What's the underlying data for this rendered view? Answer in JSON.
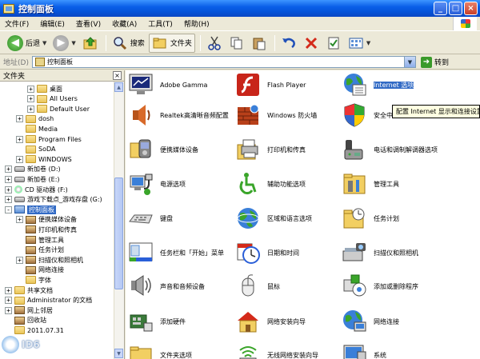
{
  "window": {
    "title": "控制面板",
    "minimize": "_",
    "maximize": "□",
    "close": "×"
  },
  "menubar": [
    "文件(F)",
    "编辑(E)",
    "查看(V)",
    "收藏(A)",
    "工具(T)",
    "帮助(H)"
  ],
  "toolbar": {
    "back": "后退",
    "search": "搜索",
    "folders": "文件夹"
  },
  "address": {
    "label": "地址(D)",
    "value": "控制面板",
    "go": "转到"
  },
  "folder_pane": {
    "title": "文件夹",
    "close": "×",
    "tree": [
      {
        "label": "桌面",
        "pm": "+",
        "icon": "folder"
      },
      {
        "label": "All Users",
        "pm": "+",
        "icon": "folder"
      },
      {
        "label": "Default User",
        "pm": "+",
        "icon": "folder"
      },
      {
        "label": "dosh",
        "pm": "+",
        "icon": "folder"
      },
      {
        "label": "Media",
        "pm": "",
        "icon": "folder"
      },
      {
        "label": "Program Files",
        "pm": "+",
        "icon": "folder"
      },
      {
        "label": "SoDA",
        "pm": "",
        "icon": "folder"
      },
      {
        "label": "WINDOWS",
        "pm": "+",
        "icon": "folder"
      },
      {
        "label": "新加卷 (D:)",
        "pm": "+",
        "icon": "drive"
      },
      {
        "label": "新加卷 (E:)",
        "pm": "+",
        "icon": "drive"
      },
      {
        "label": "CD 驱动器 (F:)",
        "pm": "+",
        "icon": "cd"
      },
      {
        "label": "游戏下载点_游戏存盘 (G:)",
        "pm": "+",
        "icon": "drive"
      },
      {
        "label": "控制面板",
        "pm": "-",
        "icon": "cp"
      },
      {
        "label": "便携媒体设备",
        "pm": "+",
        "icon": "misc"
      },
      {
        "label": "打印机和传真",
        "pm": "",
        "icon": "misc"
      },
      {
        "label": "管理工具",
        "pm": "",
        "icon": "misc"
      },
      {
        "label": "任务计划",
        "pm": "",
        "icon": "misc"
      },
      {
        "label": "扫描仪和照相机",
        "pm": "+",
        "icon": "misc"
      },
      {
        "label": "网络连接",
        "pm": "",
        "icon": "misc"
      },
      {
        "label": "字体",
        "pm": "",
        "icon": "folder"
      },
      {
        "label": "共享文档",
        "pm": "+",
        "icon": "folder"
      },
      {
        "label": "Administrator 的文档",
        "pm": "+",
        "icon": "folder"
      },
      {
        "label": "网上邻居",
        "pm": "+",
        "icon": "misc"
      },
      {
        "label": "回收站",
        "pm": "",
        "icon": "misc"
      },
      {
        "label": "2011.07.31",
        "pm": "",
        "icon": "folder"
      }
    ]
  },
  "items": [
    {
      "label": "Adobe Gamma",
      "icon": "monitor"
    },
    {
      "label": "Flash Player",
      "icon": "flash"
    },
    {
      "label": "Internet 选项",
      "icon": "globe",
      "selected": true
    },
    {
      "label": "Realtek高清晰音频配置",
      "icon": "speaker"
    },
    {
      "label": "Windows 防火墙",
      "icon": "firewall"
    },
    {
      "label": "安全中心",
      "icon": "shield"
    },
    {
      "label": "便携媒体设备",
      "icon": "media-device"
    },
    {
      "label": "打印机和传真",
      "icon": "printer"
    },
    {
      "label": "电话和调制解调器选项",
      "icon": "phone"
    },
    {
      "label": "电源选项",
      "icon": "power"
    },
    {
      "label": "辅助功能选项",
      "icon": "accessibility"
    },
    {
      "label": "管理工具",
      "icon": "admin-tools"
    },
    {
      "label": "键盘",
      "icon": "keyboard"
    },
    {
      "label": "区域和语言选项",
      "icon": "region"
    },
    {
      "label": "任务计划",
      "icon": "task-folder"
    },
    {
      "label": "任务栏和「开始」菜单",
      "icon": "taskbar"
    },
    {
      "label": "日期和时间",
      "icon": "clock"
    },
    {
      "label": "扫描仪和照相机",
      "icon": "scanner"
    },
    {
      "label": "声音和音频设备",
      "icon": "audio"
    },
    {
      "label": "鼠标",
      "icon": "mouse"
    },
    {
      "label": "添加或删除程序",
      "icon": "add-remove"
    },
    {
      "label": "添加硬件",
      "icon": "hardware"
    },
    {
      "label": "网络安装向导",
      "icon": "home-network"
    },
    {
      "label": "网络连接",
      "icon": "network"
    },
    {
      "label": "文件夹选项",
      "icon": "folder-options"
    },
    {
      "label": "无线网络安装向导",
      "icon": "wireless"
    },
    {
      "label": "系统",
      "icon": "system"
    }
  ],
  "tooltip": "配置 Internet 显示和连接设置。",
  "watermark": "ID6"
}
